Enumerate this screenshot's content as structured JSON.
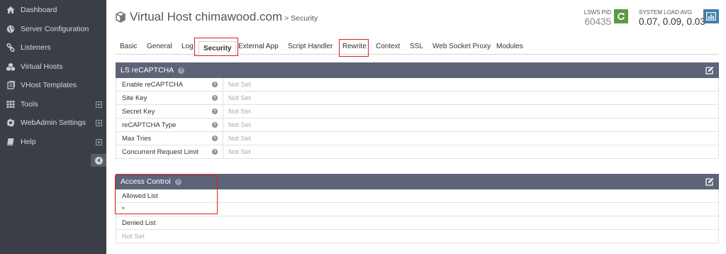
{
  "sidebar": {
    "items": [
      {
        "label": "Dashboard",
        "icon": "home-icon",
        "expandable": false
      },
      {
        "label": "Server Configuration",
        "icon": "globe-icon",
        "expandable": false
      },
      {
        "label": "Listeners",
        "icon": "link-icon",
        "expandable": false
      },
      {
        "label": "Virtual Hosts",
        "icon": "cubes-icon",
        "expandable": false
      },
      {
        "label": "VHost Templates",
        "icon": "template-icon",
        "expandable": false
      },
      {
        "label": "Tools",
        "icon": "grid-icon",
        "expandable": true
      },
      {
        "label": "WebAdmin Settings",
        "icon": "gear-icon",
        "expandable": true
      },
      {
        "label": "Help",
        "icon": "book-icon",
        "expandable": true
      }
    ]
  },
  "header": {
    "title": "Virtual Host chimawood.com",
    "subtitle": "> Security",
    "lsws_pid_label": "LSWS PID",
    "lsws_pid_value": "60435",
    "sysload_label": "SYSTEM LOAD AVG",
    "sysload_value": "0.07, 0.09, 0.03"
  },
  "tabs": [
    "Basic",
    "General",
    "Log",
    "Security",
    "External App",
    "Script Handler",
    "Rewrite",
    "Context",
    "SSL",
    "Web Socket Proxy",
    "Modules"
  ],
  "active_tab": "Security",
  "recaptcha": {
    "title": "LS reCAPTCHA",
    "rows": [
      {
        "label": "Enable reCAPTCHA",
        "value": "Not Set"
      },
      {
        "label": "Site Key",
        "value": "Not Set"
      },
      {
        "label": "Secret Key",
        "value": "Not Set"
      },
      {
        "label": "reCAPTCHA Type",
        "value": "Not Set"
      },
      {
        "label": "Max Tries",
        "value": "Not Set"
      },
      {
        "label": "Concurrent Request Limit",
        "value": "Not Set"
      }
    ]
  },
  "access_control": {
    "title": "Access Control",
    "allowed_label": "Allowed List",
    "allowed_value": "*",
    "denied_label": "Denied List",
    "denied_value": "Not Set"
  },
  "colors": {
    "sidebar_bg": "#3a3f47",
    "panel_header": "#5d6478",
    "restart_green": "#5a9b45",
    "stats_blue": "#3f81a9",
    "highlight_red": "#dd1f1f"
  }
}
